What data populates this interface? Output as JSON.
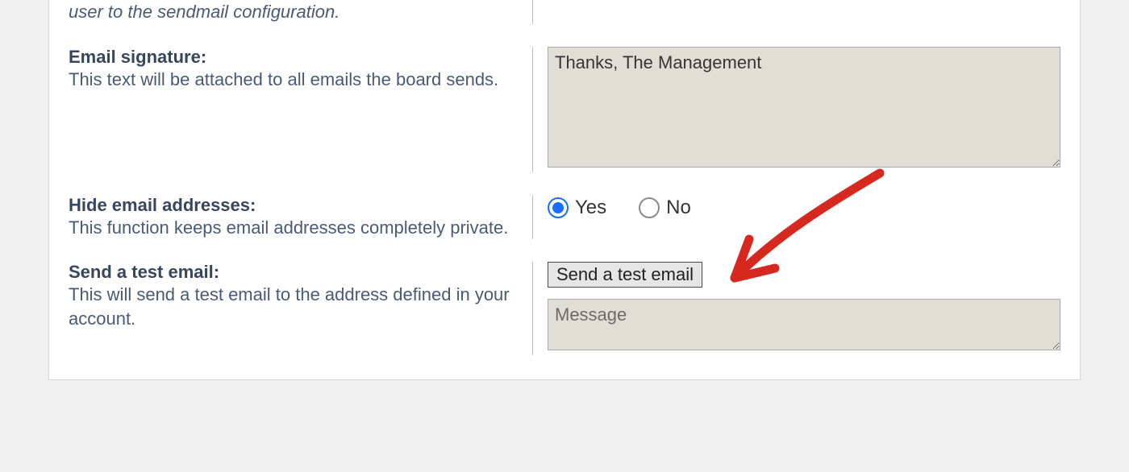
{
  "truncated_note": "user to the sendmail configuration.",
  "signature": {
    "label": "Email signature:",
    "desc": "This text will be attached to all emails the board sends.",
    "value": "Thanks, The Management"
  },
  "hide": {
    "label": "Hide email addresses:",
    "desc": "This function keeps email addresses completely private.",
    "yes": "Yes",
    "no": "No"
  },
  "test": {
    "label": "Send a test email:",
    "desc": "This will send a test email to the address defined in your account.",
    "button": "Send a test email",
    "placeholder": "Message"
  }
}
